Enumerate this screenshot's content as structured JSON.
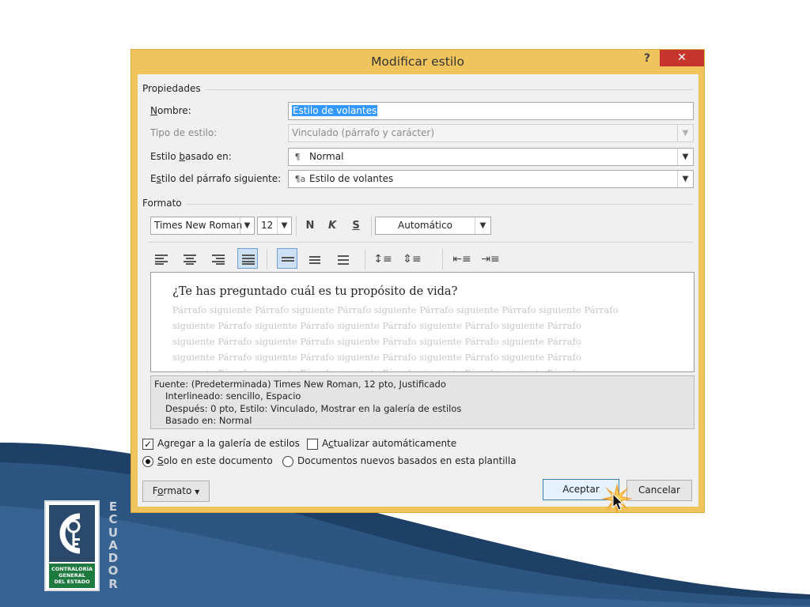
{
  "dialog": {
    "title": "Modificar estilo",
    "help_label": "?",
    "close_label": "✕"
  },
  "properties": {
    "group_label": "Propiedades",
    "name_label": "Nombre:",
    "name_value": "Estilo de volantes",
    "style_type_label": "Tipo de estilo:",
    "style_type_value": "Vinculado (párrafo y carácter)",
    "based_on_label": "Estilo basado en:",
    "based_on_value": "Normal",
    "next_paragraph_label": "Estilo del párrafo siguiente:",
    "next_paragraph_value": "Estilo de volantes"
  },
  "format": {
    "group_label": "Formato",
    "font_name": "Times New Roman",
    "font_size": "12",
    "bold_label": "N",
    "italic_label": "K",
    "underline_label": "S",
    "color_value": "Automático"
  },
  "preview": {
    "main_text": "¿Te has preguntado cuál es tu propósito de vida?",
    "ghost_lines": [
      "Párrafo siguiente Párrafo siguiente Párrafo siguiente Párrafo siguiente Párrafo siguiente Párrafo",
      "siguiente Párrafo siguiente Párrafo siguiente Párrafo siguiente Párrafo siguiente Párrafo",
      "siguiente Párrafo siguiente Párrafo siguiente Párrafo siguiente Párrafo siguiente Párrafo",
      "siguiente Párrafo siguiente Párrafo siguiente Párrafo siguiente Párrafo siguiente Párrafo",
      "siguiente Párrafo siguiente Párrafo siguiente Párrafo siguiente Párrafo siguiente Párrafo"
    ]
  },
  "description": {
    "line1": "Fuente: (Predeterminada) Times New Roman, 12 pto, Justificado",
    "line2": "Interlineado:  sencillo, Espacio",
    "line3": "Después:  0 pto, Estilo: Vinculado, Mostrar en la galería de estilos",
    "line4": "Basado en: Normal"
  },
  "options": {
    "add_gallery_label": "Agregar a la galería de estilos",
    "add_gallery_checked": true,
    "auto_update_label": "Actualizar automáticamente",
    "auto_update_checked": false,
    "only_doc_label": "Solo en este documento",
    "new_docs_label": "Documentos nuevos basados en esta plantilla",
    "selected_scope": "only_doc"
  },
  "buttons": {
    "format_label": "Formato",
    "ok_label": "Aceptar",
    "cancel_label": "Cancelar"
  },
  "logo": {
    "org_lines": [
      "CONTRALORÍA",
      "GENERAL",
      "DEL ESTADO"
    ],
    "country_letters": [
      "E",
      "C",
      "U",
      "A",
      "D",
      "O",
      "R"
    ]
  },
  "colors": {
    "dialog_frame": "#f0c45c",
    "close_button": "#c7342b",
    "selection": "#3399ff",
    "slide_wave_dark": "#1e3f66",
    "slide_wave_light": "#3f6f9f",
    "logo_green": "#1f7a3f"
  }
}
